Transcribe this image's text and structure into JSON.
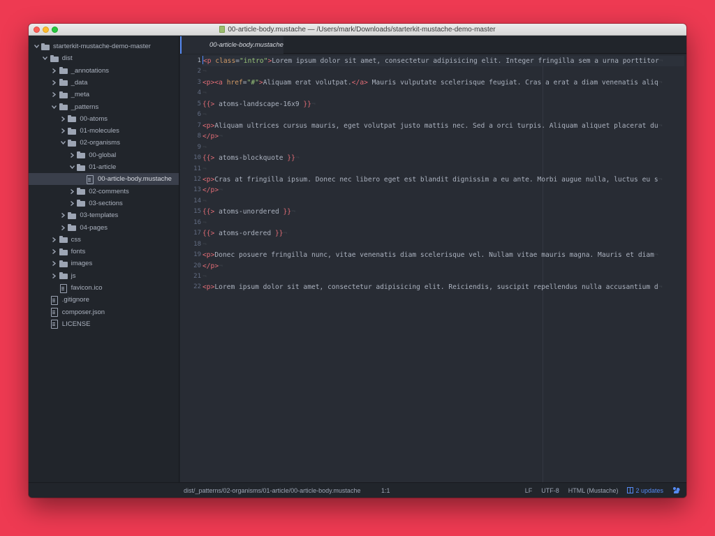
{
  "window": {
    "title": "00-article-body.mustache — /Users/mark/Downloads/starterkit-mustache-demo-master"
  },
  "tree": [
    {
      "label": "starterkit-mustache-demo-master",
      "kind": "repo",
      "depth": 0,
      "expanded": true
    },
    {
      "label": "dist",
      "kind": "folder",
      "depth": 1,
      "expanded": true
    },
    {
      "label": "_annotations",
      "kind": "folder",
      "depth": 2,
      "expanded": false
    },
    {
      "label": "_data",
      "kind": "folder",
      "depth": 2,
      "expanded": false
    },
    {
      "label": "_meta",
      "kind": "folder",
      "depth": 2,
      "expanded": false
    },
    {
      "label": "_patterns",
      "kind": "folder",
      "depth": 2,
      "expanded": true
    },
    {
      "label": "00-atoms",
      "kind": "folder",
      "depth": 3,
      "expanded": false
    },
    {
      "label": "01-molecules",
      "kind": "folder",
      "depth": 3,
      "expanded": false
    },
    {
      "label": "02-organisms",
      "kind": "folder",
      "depth": 3,
      "expanded": true
    },
    {
      "label": "00-global",
      "kind": "folder",
      "depth": 4,
      "expanded": false
    },
    {
      "label": "01-article",
      "kind": "folder",
      "depth": 4,
      "expanded": true
    },
    {
      "label": "00-article-body.mustache",
      "kind": "file",
      "depth": 5,
      "selected": true
    },
    {
      "label": "02-comments",
      "kind": "folder",
      "depth": 4,
      "expanded": false
    },
    {
      "label": "03-sections",
      "kind": "folder",
      "depth": 4,
      "expanded": false
    },
    {
      "label": "03-templates",
      "kind": "folder",
      "depth": 3,
      "expanded": false
    },
    {
      "label": "04-pages",
      "kind": "folder",
      "depth": 3,
      "expanded": false
    },
    {
      "label": "css",
      "kind": "folder",
      "depth": 2,
      "expanded": false
    },
    {
      "label": "fonts",
      "kind": "folder",
      "depth": 2,
      "expanded": false
    },
    {
      "label": "images",
      "kind": "folder",
      "depth": 2,
      "expanded": false
    },
    {
      "label": "js",
      "kind": "folder",
      "depth": 2,
      "expanded": false
    },
    {
      "label": "favicon.ico",
      "kind": "file",
      "depth": 2
    },
    {
      "label": ".gitignore",
      "kind": "file",
      "depth": 1
    },
    {
      "label": "composer.json",
      "kind": "file",
      "depth": 1
    },
    {
      "label": "LICENSE",
      "kind": "file",
      "depth": 1
    }
  ],
  "tab": {
    "label": "00-article-body.mustache"
  },
  "editor": {
    "lines": [
      "<p class=\"intro\">Lorem ipsum dolor sit amet, consectetur adipisicing elit. Integer fringilla sem a urna porttitor",
      "",
      "<p><a href=\"#\">Aliquam erat volutpat.</a> Mauris vulputate scelerisque feugiat. Cras a erat a diam venenatis aliq",
      "",
      "{{> atoms-landscape-16x9 }}",
      "",
      "<p>Aliquam ultrices cursus mauris, eget volutpat justo mattis nec. Sed a orci turpis. Aliquam aliquet placerat du",
      "</p>",
      "",
      "{{> atoms-blockquote }}",
      "",
      "<p>Cras at fringilla ipsum. Donec nec libero eget est blandit dignissim a eu ante. Morbi augue nulla, luctus eu s",
      "</p>",
      "",
      "{{> atoms-unordered }}",
      "",
      "{{> atoms-ordered }}",
      "",
      "<p>Donec posuere fringilla nunc, vitae venenatis diam scelerisque vel. Nullam vitae mauris magna. Mauris et diam",
      "</p>",
      "",
      "<p>Lorem ipsum dolor sit amet, consectetur adipisicing elit. Reiciendis, suscipit repellendus nulla accusantium d"
    ],
    "current_line": 1
  },
  "status": {
    "path": "dist/_patterns/02-organisms/01-article/00-article-body.mustache",
    "cursor_pos": "1:1",
    "line_ending": "LF",
    "encoding": "UTF-8",
    "grammar": "HTML (Mustache)",
    "updates": "2 updates"
  },
  "colors": {
    "background": "#ee3a52",
    "editor_bg": "#282c34",
    "sidebar_bg": "#21252b",
    "accent": "#568af2",
    "tag": "#e06c75",
    "attr": "#d19a66",
    "string": "#98c379"
  }
}
